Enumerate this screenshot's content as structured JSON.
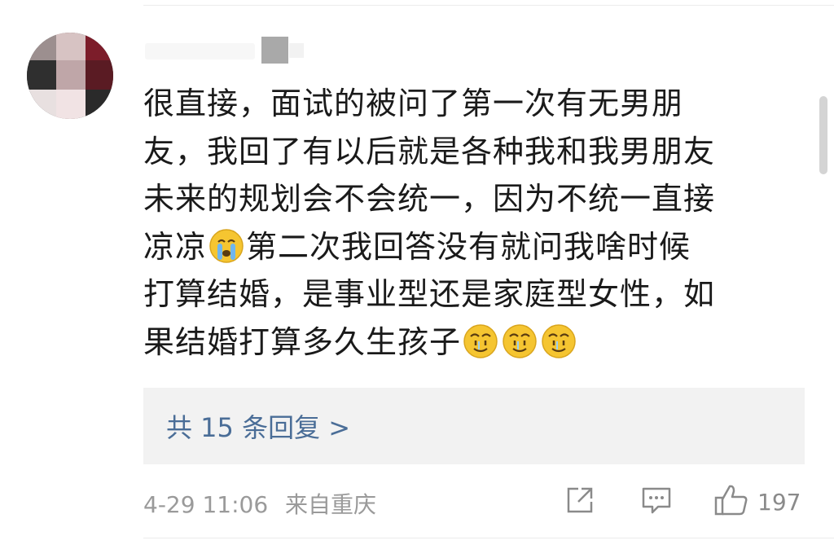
{
  "comment": {
    "lines": [
      "很直接，面试的被问了第一次有无男朋",
      "友，我回了有以后就是各种我和我男朋友",
      "未来的规划会不会统一，因为不统一直接",
      "凉凉",
      "第二次我回答没有就问我啥时候",
      "打算结婚，是事业型还是家庭型女性，如",
      "果结婚打算多久生孩子"
    ]
  },
  "replies": {
    "label": "共 15 条回复 >"
  },
  "meta": {
    "time": "4-29 11:06",
    "source": "来自重庆"
  },
  "actions": {
    "like_count": "197"
  },
  "icons": {
    "crying": "crying-face-icon",
    "sweat_smile": "sweat-smile-face-icon",
    "share": "share-icon",
    "comment": "comment-icon",
    "like": "thumbs-up-icon"
  },
  "colors": {
    "link": "#4a6d97",
    "meta": "#9a9a9a",
    "text": "#1a1a1a",
    "reply_box_bg": "#f2f2f2"
  }
}
